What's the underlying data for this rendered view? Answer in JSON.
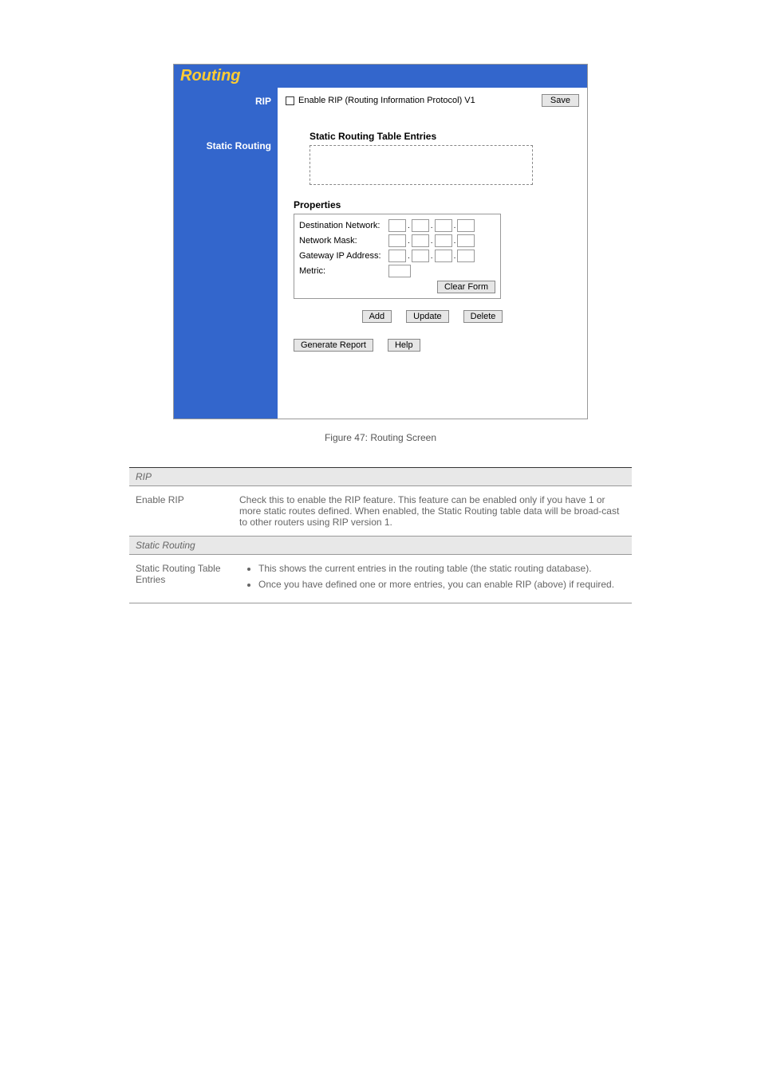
{
  "panel": {
    "title": "Routing",
    "sidebar": {
      "rip_label": "RIP",
      "static_label": "Static Routing"
    },
    "rip": {
      "checkbox_label": "Enable RIP (Routing Information Protocol) V1",
      "save_btn": "Save"
    },
    "static": {
      "entries_heading": "Static Routing Table Entries",
      "properties_heading": "Properties",
      "labels": {
        "dest": "Destination Network:",
        "mask": "Network Mask:",
        "gateway": "Gateway IP Address:",
        "metric": "Metric:"
      },
      "clear_btn": "Clear Form",
      "add_btn": "Add",
      "update_btn": "Update",
      "delete_btn": "Delete"
    },
    "bottom": {
      "report_btn": "Generate Report",
      "help_btn": "Help"
    }
  },
  "caption": "Figure 47: Routing Screen",
  "table": {
    "section1": "RIP",
    "row1_label": "Enable RIP",
    "row1_text": "Check this to enable the RIP feature. This feature can be enabled only if you have  1 or more static routes defined. When enabled, the Static Routing table data will be broad-cast to other routers using RIP version 1.",
    "section2": "Static Routing",
    "row2_label": "Static Routing Table Entries",
    "row2_li1": "This shows the current entries in the routing table (the static routing database).",
    "row2_li2": "Once you have defined one or more entries, you can enable RIP (above) if required."
  }
}
